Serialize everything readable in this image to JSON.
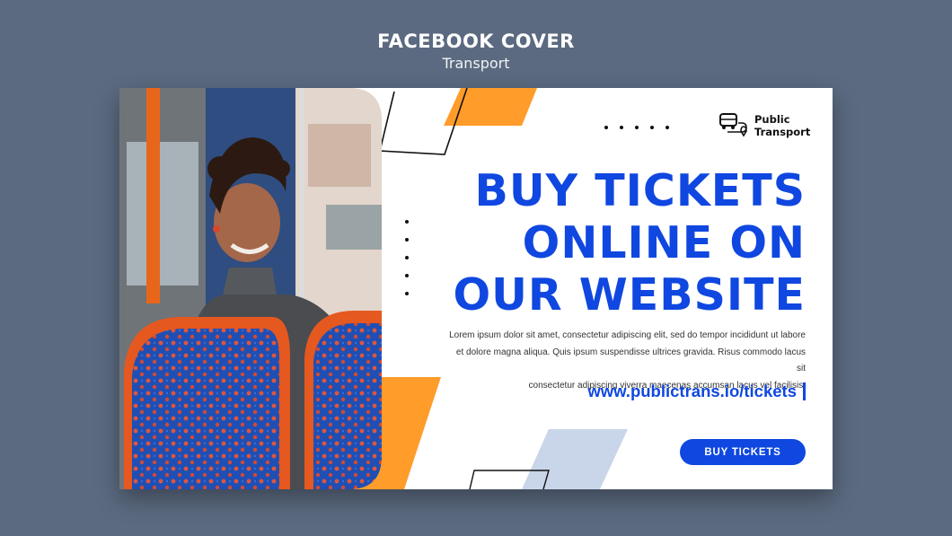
{
  "header": {
    "title": "FACEBOOK COVER",
    "subtitle": "Transport"
  },
  "cover": {
    "logo": {
      "icon": "bus-route-icon",
      "line1": "Public",
      "line2": "Transport"
    },
    "headline": [
      "BUY TICKETS",
      "ONLINE ON",
      "OUR WEBSITE"
    ],
    "body_lines": [
      "Lorem ipsum dolor sit amet, consectetur adipiscing elit, sed do tempor incididunt ut labore",
      "et dolore magna aliqua. Quis ipsum suspendisse ultrices gravida. Risus commodo lacus sit",
      "consectetur adipiscing viverra maecenas accumsan lacus vel facilisis."
    ],
    "url": "www.publictrans.io/tickets",
    "cta_label": "BUY TICKETS",
    "colors": {
      "accent": "#0f47e0",
      "orange": "#ff9c2a",
      "pale_blue": "#c9d5e8",
      "background": "#5b6a80"
    }
  }
}
